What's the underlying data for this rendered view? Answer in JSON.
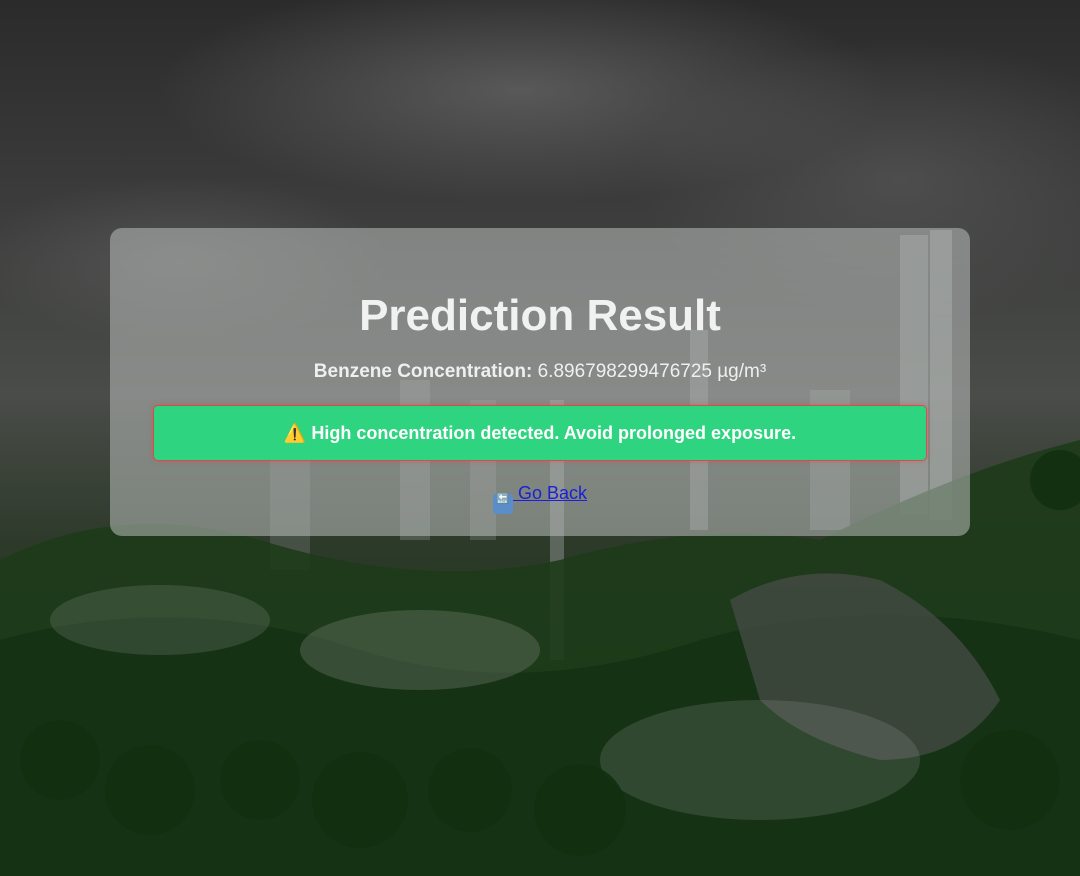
{
  "page": {
    "title": "Prediction Result"
  },
  "result": {
    "label": "Benzene Concentration:",
    "value": "6.896798299476725 µg/m³"
  },
  "alert": {
    "icon": "⚠️",
    "message": "High concentration detected. Avoid prolonged exposure.",
    "colors": {
      "background": "#2ed47f",
      "border": "#dc4646"
    }
  },
  "nav": {
    "back_icon": "🔙",
    "back_label": " Go Back"
  }
}
